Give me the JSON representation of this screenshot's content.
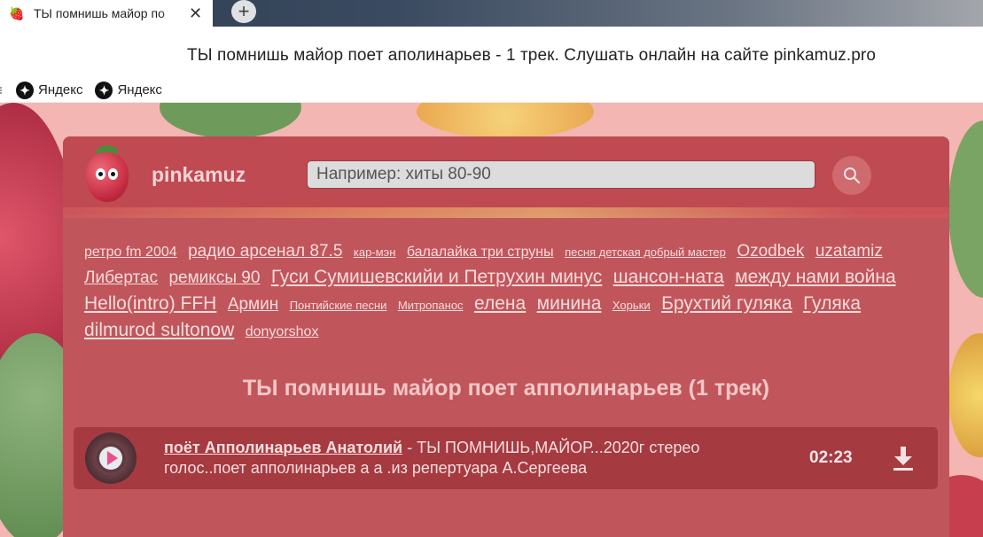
{
  "browser": {
    "tab": {
      "favicon": "raspberry-icon",
      "title": "ТЫ помнишь майор по",
      "close": "✕"
    },
    "newtab": "+",
    "page_title": "ТЫ помнишь майор поет аполинарьев - 1 трек. Слушать онлайн на сайте pinkamuz.pro",
    "bookmarks": [
      {
        "icon": "yandex-icon",
        "label": "Яндекс"
      },
      {
        "icon": "yandex-icon",
        "label": "Яндекс"
      }
    ]
  },
  "site": {
    "name": "pinkamuz",
    "search": {
      "placeholder": "Например: хиты 80-90",
      "value": ""
    }
  },
  "tags": [
    {
      "label": "ретро fm 2004",
      "size": "m"
    },
    {
      "label": "радио арсенал 87.5",
      "size": "l"
    },
    {
      "label": "кар-мэн",
      "size": "s"
    },
    {
      "label": "балалайка три струны",
      "size": "m"
    },
    {
      "label": "песня детская добрый мастер",
      "size": "s"
    },
    {
      "label": "Ozodbek",
      "size": "l"
    },
    {
      "label": "uzatamiz",
      "size": "l"
    },
    {
      "label": "Либертас",
      "size": "l"
    },
    {
      "label": "ремиксы 90",
      "size": "l"
    },
    {
      "label": "Гуси Сумишевскийи и Петрухин минус",
      "size": "xl"
    },
    {
      "label": "шансон-ната",
      "size": "xl"
    },
    {
      "label": "между нами война",
      "size": "xl"
    },
    {
      "label": "Hello(intro) FFH",
      "size": "xl"
    },
    {
      "label": "Армин",
      "size": "l"
    },
    {
      "label": "Понтийские песни",
      "size": "s"
    },
    {
      "label": "Митропанос",
      "size": "s"
    },
    {
      "label": "елена",
      "size": "xl"
    },
    {
      "label": "минина",
      "size": "xl"
    },
    {
      "label": "Хорьки",
      "size": "s"
    },
    {
      "label": "Брухтий гуляка",
      "size": "xl"
    },
    {
      "label": "Гуляка",
      "size": "xl"
    },
    {
      "label": "dilmurod sultonow",
      "size": "xl"
    },
    {
      "label": "donyorshox",
      "size": "m"
    }
  ],
  "results": {
    "heading": "ТЫ помнишь майор поет апполинарьев (1 трек)",
    "tracks": [
      {
        "artist": "поёт Апполинарьев Анатолий",
        "separator": " - ",
        "title": "ТЫ ПОМНИШЬ,МАЙОР...2020г стерео голос..поет апполинарьев а а .из репертуара А.Сергеева",
        "duration": "02:23",
        "play_icon": "play-icon",
        "download_icon": "download-icon"
      }
    ]
  }
}
